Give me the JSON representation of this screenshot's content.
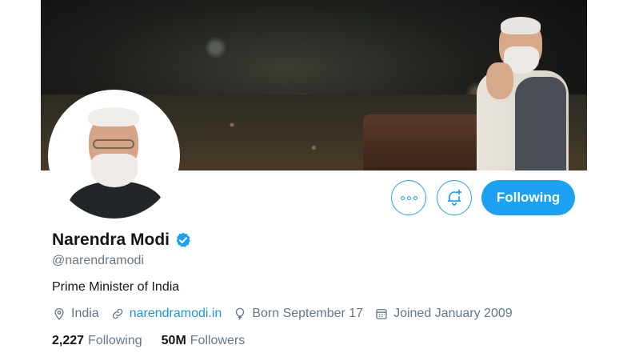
{
  "profile": {
    "name": "Narendra Modi",
    "handle": "@narendramodi",
    "bio": "Prime Minister of India",
    "location": "India",
    "website": "narendramodi.in",
    "born": "Born September 17",
    "joined": "Joined January 2009",
    "verified": true
  },
  "actions": {
    "following_label": "Following",
    "more_icon": "more-icon",
    "notifications_icon": "bell-plus-icon"
  },
  "stats": {
    "following_count": "2,227",
    "following_label": "Following",
    "followers_count": "50M",
    "followers_label": "Followers"
  },
  "colors": {
    "accent": "#1da1f2",
    "link": "#1b95e0",
    "text": "#14171a",
    "secondary": "#657786"
  }
}
